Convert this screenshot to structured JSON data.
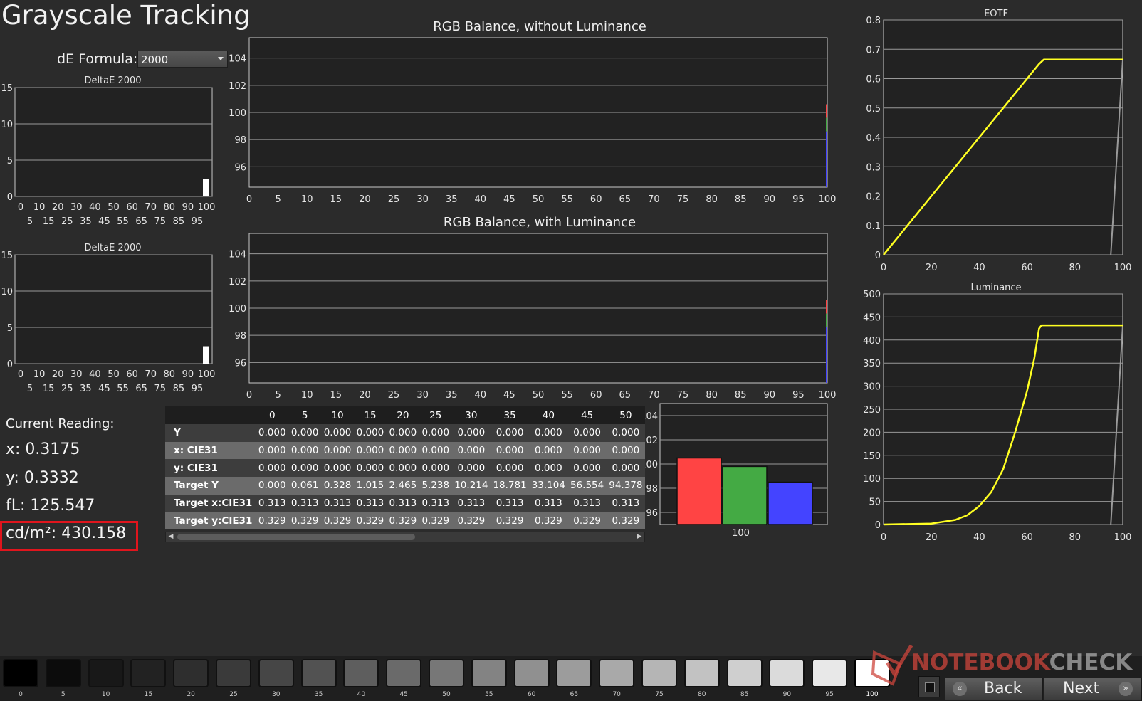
{
  "title": "Grayscale Tracking",
  "de_formula": {
    "label": "dE Formula:",
    "value": "2000"
  },
  "reading": {
    "header": "Current Reading:",
    "x": "x: 0.3175",
    "y": "y: 0.3332",
    "fl": "fL: 125.547",
    "cdm2": "cd/m²: 430.158"
  },
  "colors": {
    "background": "#2b2b2b",
    "plot_bg": "#222222",
    "red": "#ff4444",
    "green": "#44aa44",
    "blue": "#4444ff",
    "yellow": "#ffff22",
    "highlight_border": "#e0151d"
  },
  "table": {
    "columns": [
      "",
      "0",
      "5",
      "10",
      "15",
      "20",
      "25",
      "30",
      "35",
      "40",
      "45",
      "50"
    ],
    "rows": [
      {
        "label": "Y",
        "values": [
          "0.000",
          "0.000",
          "0.000",
          "0.000",
          "0.000",
          "0.000",
          "0.000",
          "0.000",
          "0.000",
          "0.000",
          "0.000"
        ]
      },
      {
        "label": "x: CIE31",
        "values": [
          "0.000",
          "0.000",
          "0.000",
          "0.000",
          "0.000",
          "0.000",
          "0.000",
          "0.000",
          "0.000",
          "0.000",
          "0.000"
        ]
      },
      {
        "label": "y: CIE31",
        "values": [
          "0.000",
          "0.000",
          "0.000",
          "0.000",
          "0.000",
          "0.000",
          "0.000",
          "0.000",
          "0.000",
          "0.000",
          "0.000"
        ]
      },
      {
        "label": "Target Y",
        "values": [
          "0.000",
          "0.061",
          "0.328",
          "1.015",
          "2.465",
          "5.238",
          "10.214",
          "18.781",
          "33.104",
          "56.554",
          "94.378"
        ]
      },
      {
        "label": "Target x:CIE31",
        "values": [
          "0.313",
          "0.313",
          "0.313",
          "0.313",
          "0.313",
          "0.313",
          "0.313",
          "0.313",
          "0.313",
          "0.313",
          "0.313"
        ]
      },
      {
        "label": "Target y:CIE31",
        "values": [
          "0.329",
          "0.329",
          "0.329",
          "0.329",
          "0.329",
          "0.329",
          "0.329",
          "0.329",
          "0.329",
          "0.329",
          "0.329"
        ]
      }
    ]
  },
  "swatches": [
    {
      "label": "0",
      "gray": "#000000"
    },
    {
      "label": "5",
      "gray": "#0c0c0c"
    },
    {
      "label": "10",
      "gray": "#181818"
    },
    {
      "label": "15",
      "gray": "#222222"
    },
    {
      "label": "20",
      "gray": "#2e2e2e"
    },
    {
      "label": "25",
      "gray": "#3a3a3a"
    },
    {
      "label": "30",
      "gray": "#464646"
    },
    {
      "label": "35",
      "gray": "#525252"
    },
    {
      "label": "40",
      "gray": "#5e5e5e"
    },
    {
      "label": "45",
      "gray": "#6a6a6a"
    },
    {
      "label": "50",
      "gray": "#777777"
    },
    {
      "label": "55",
      "gray": "#838383"
    },
    {
      "label": "60",
      "gray": "#909090"
    },
    {
      "label": "65",
      "gray": "#9c9c9c"
    },
    {
      "label": "70",
      "gray": "#a9a9a9"
    },
    {
      "label": "75",
      "gray": "#b5b5b5"
    },
    {
      "label": "80",
      "gray": "#c2c2c2"
    },
    {
      "label": "85",
      "gray": "#cfcfcf"
    },
    {
      "label": "90",
      "gray": "#dbdbdb"
    },
    {
      "label": "95",
      "gray": "#e8e8e8"
    },
    {
      "label": "100",
      "gray": "#ffffff"
    }
  ],
  "nav": {
    "back": "Back",
    "next": "Next"
  },
  "watermark": {
    "part1": "NOTEBOOK",
    "part2": "CHECK"
  },
  "chart_data": [
    {
      "id": "deltae-1",
      "type": "bar",
      "title": "DeltaE 2000",
      "ylim": [
        0,
        15
      ],
      "yticks": [
        "0",
        "5",
        "10",
        "15"
      ],
      "xticks_top": [
        "0",
        "10",
        "20",
        "30",
        "40",
        "50",
        "60",
        "70",
        "80",
        "90",
        "100"
      ],
      "xticks_bottom": [
        "5",
        "15",
        "25",
        "35",
        "45",
        "55",
        "65",
        "75",
        "85",
        "95"
      ],
      "bars": [
        {
          "x": 100,
          "value": 2.4
        }
      ]
    },
    {
      "id": "deltae-2",
      "type": "bar",
      "title": "DeltaE 2000",
      "ylim": [
        0,
        15
      ],
      "yticks": [
        "0",
        "5",
        "10",
        "15"
      ],
      "xticks_top": [
        "0",
        "10",
        "20",
        "30",
        "40",
        "50",
        "60",
        "70",
        "80",
        "90",
        "100"
      ],
      "xticks_bottom": [
        "5",
        "15",
        "25",
        "35",
        "45",
        "55",
        "65",
        "75",
        "85",
        "95"
      ],
      "bars": [
        {
          "x": 100,
          "value": 2.4
        }
      ]
    },
    {
      "id": "rgb-no-lum",
      "type": "line",
      "title": "RGB Balance, without Luminance",
      "ylim": [
        94.5,
        105.5
      ],
      "yticks": [
        "96",
        "98",
        "100",
        "102",
        "104"
      ],
      "xticks": [
        "0",
        "5",
        "10",
        "15",
        "20",
        "25",
        "30",
        "35",
        "40",
        "45",
        "50",
        "55",
        "60",
        "65",
        "70",
        "75",
        "80",
        "85",
        "90",
        "95",
        "100"
      ],
      "series": [
        {
          "color": "red",
          "x": 100,
          "range": [
            99.6,
            100.6
          ]
        },
        {
          "color": "green",
          "x": 100,
          "range": [
            98.6,
            99.6
          ]
        },
        {
          "color": "blue",
          "x": 100,
          "range": [
            94.5,
            98.6
          ]
        }
      ]
    },
    {
      "id": "rgb-with-lum",
      "type": "line",
      "title": "RGB Balance, with Luminance",
      "ylim": [
        94.5,
        105.5
      ],
      "yticks": [
        "96",
        "98",
        "100",
        "102",
        "104"
      ],
      "xticks": [
        "0",
        "5",
        "10",
        "15",
        "20",
        "25",
        "30",
        "35",
        "40",
        "45",
        "50",
        "55",
        "60",
        "65",
        "70",
        "75",
        "80",
        "85",
        "90",
        "95",
        "100"
      ],
      "series": [
        {
          "color": "red",
          "x": 100,
          "range": [
            99.6,
            100.6
          ]
        },
        {
          "color": "green",
          "x": 100,
          "range": [
            98.6,
            99.6
          ]
        },
        {
          "color": "blue",
          "x": 100,
          "range": [
            94.5,
            98.6
          ]
        }
      ]
    },
    {
      "id": "rgb-bars",
      "type": "bar",
      "ylim": [
        95,
        105
      ],
      "yticks": [
        "96",
        "98",
        "100",
        "102",
        "104"
      ],
      "categories": [
        "100"
      ],
      "series": [
        {
          "name": "R",
          "color": "red",
          "value": 100.5
        },
        {
          "name": "G",
          "color": "green",
          "value": 99.8
        },
        {
          "name": "B",
          "color": "blue",
          "value": 98.5
        }
      ]
    },
    {
      "id": "eotf",
      "type": "line",
      "title": "EOTF",
      "xlim": [
        0,
        100
      ],
      "ylim": [
        0,
        0.8
      ],
      "xticks": [
        "0",
        "20",
        "40",
        "60",
        "80",
        "100"
      ],
      "yticks": [
        "0",
        "0.1",
        "0.2",
        "0.3",
        "0.4",
        "0.5",
        "0.6",
        "0.7",
        "0.8"
      ],
      "series": [
        {
          "name": "measured",
          "color": "yellow",
          "x": [
            0,
            5,
            10,
            20,
            30,
            40,
            50,
            60,
            65,
            67,
            100
          ],
          "y": [
            0,
            0.05,
            0.1,
            0.2,
            0.3,
            0.4,
            0.5,
            0.6,
            0.65,
            0.665,
            0.665
          ]
        },
        {
          "name": "target",
          "color": "gray",
          "x": [
            95,
            100
          ],
          "y": [
            0,
            0.665
          ]
        }
      ]
    },
    {
      "id": "luminance",
      "type": "line",
      "title": "Luminance",
      "xlim": [
        0,
        100
      ],
      "ylim": [
        0,
        500
      ],
      "xticks": [
        "0",
        "20",
        "40",
        "60",
        "80",
        "100"
      ],
      "yticks": [
        "0",
        "50",
        "100",
        "150",
        "200",
        "250",
        "300",
        "350",
        "400",
        "450",
        "500"
      ],
      "series": [
        {
          "name": "measured",
          "color": "yellow",
          "x": [
            0,
            20,
            30,
            35,
            40,
            45,
            50,
            55,
            60,
            63,
            65,
            66,
            67,
            70,
            100
          ],
          "y": [
            0,
            2,
            10,
            20,
            40,
            70,
            120,
            200,
            290,
            360,
            425,
            432,
            432,
            432,
            432
          ]
        },
        {
          "name": "target",
          "color": "gray",
          "x": [
            95,
            100
          ],
          "y": [
            0,
            432
          ]
        }
      ]
    }
  ]
}
